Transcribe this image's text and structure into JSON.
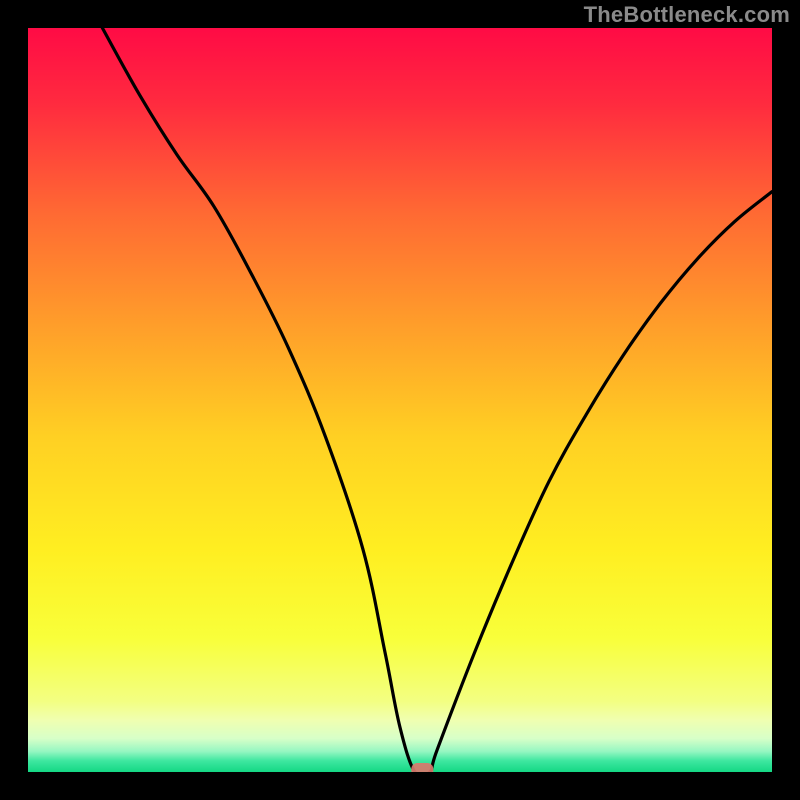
{
  "watermark": "TheBottleneck.com",
  "chart_data": {
    "type": "line",
    "title": "",
    "xlabel": "",
    "ylabel": "",
    "xlim": [
      0,
      100
    ],
    "ylim": [
      0,
      100
    ],
    "x": [
      10,
      15,
      20,
      25,
      30,
      35,
      40,
      45,
      48,
      50,
      52,
      54,
      55,
      60,
      65,
      70,
      75,
      80,
      85,
      90,
      95,
      100
    ],
    "values": [
      100,
      91,
      83,
      76,
      67,
      57,
      45,
      30,
      16,
      6,
      0,
      0,
      3,
      16,
      28,
      39,
      48,
      56,
      63,
      69,
      74,
      78
    ],
    "marker": {
      "x": 53,
      "y": 0
    },
    "gradient_bands": [
      {
        "stop": 0.0,
        "color": "#ff0b45"
      },
      {
        "stop": 0.1,
        "color": "#ff2a3f"
      },
      {
        "stop": 0.25,
        "color": "#ff6a33"
      },
      {
        "stop": 0.4,
        "color": "#ff9e2a"
      },
      {
        "stop": 0.55,
        "color": "#ffd023"
      },
      {
        "stop": 0.7,
        "color": "#ffee21"
      },
      {
        "stop": 0.82,
        "color": "#f8ff3a"
      },
      {
        "stop": 0.905,
        "color": "#f3ff82"
      },
      {
        "stop": 0.93,
        "color": "#f0ffb0"
      },
      {
        "stop": 0.955,
        "color": "#d7ffc8"
      },
      {
        "stop": 0.972,
        "color": "#97f7c2"
      },
      {
        "stop": 0.985,
        "color": "#3ee7a0"
      },
      {
        "stop": 1.0,
        "color": "#14d884"
      }
    ]
  }
}
